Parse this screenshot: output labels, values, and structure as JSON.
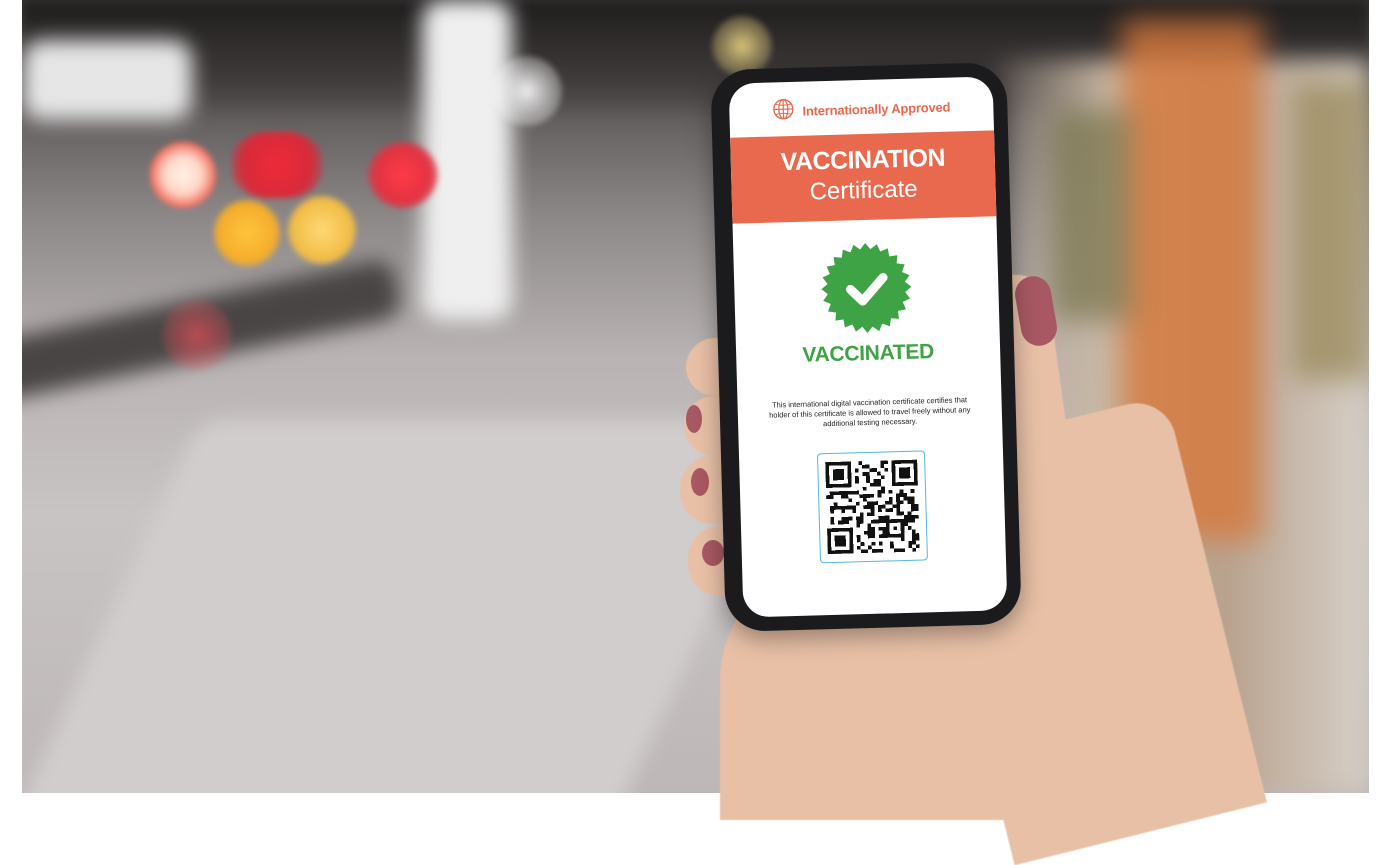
{
  "certificate": {
    "approved_label": "Internationally Approved",
    "title": "VACCINATION",
    "subtitle": "Certificate",
    "status": "VACCINATED",
    "description": "This international digital vaccination certificate certifies that holder of this certificate is allowed to travel freely without any additional testing necessary."
  },
  "icons": {
    "globe": "globe-icon",
    "seal": "checkmark-seal-icon",
    "qr": "qr-code"
  },
  "colors": {
    "accent": "#e9694e",
    "success": "#3ea345",
    "qr_border": "#55b6e6"
  }
}
